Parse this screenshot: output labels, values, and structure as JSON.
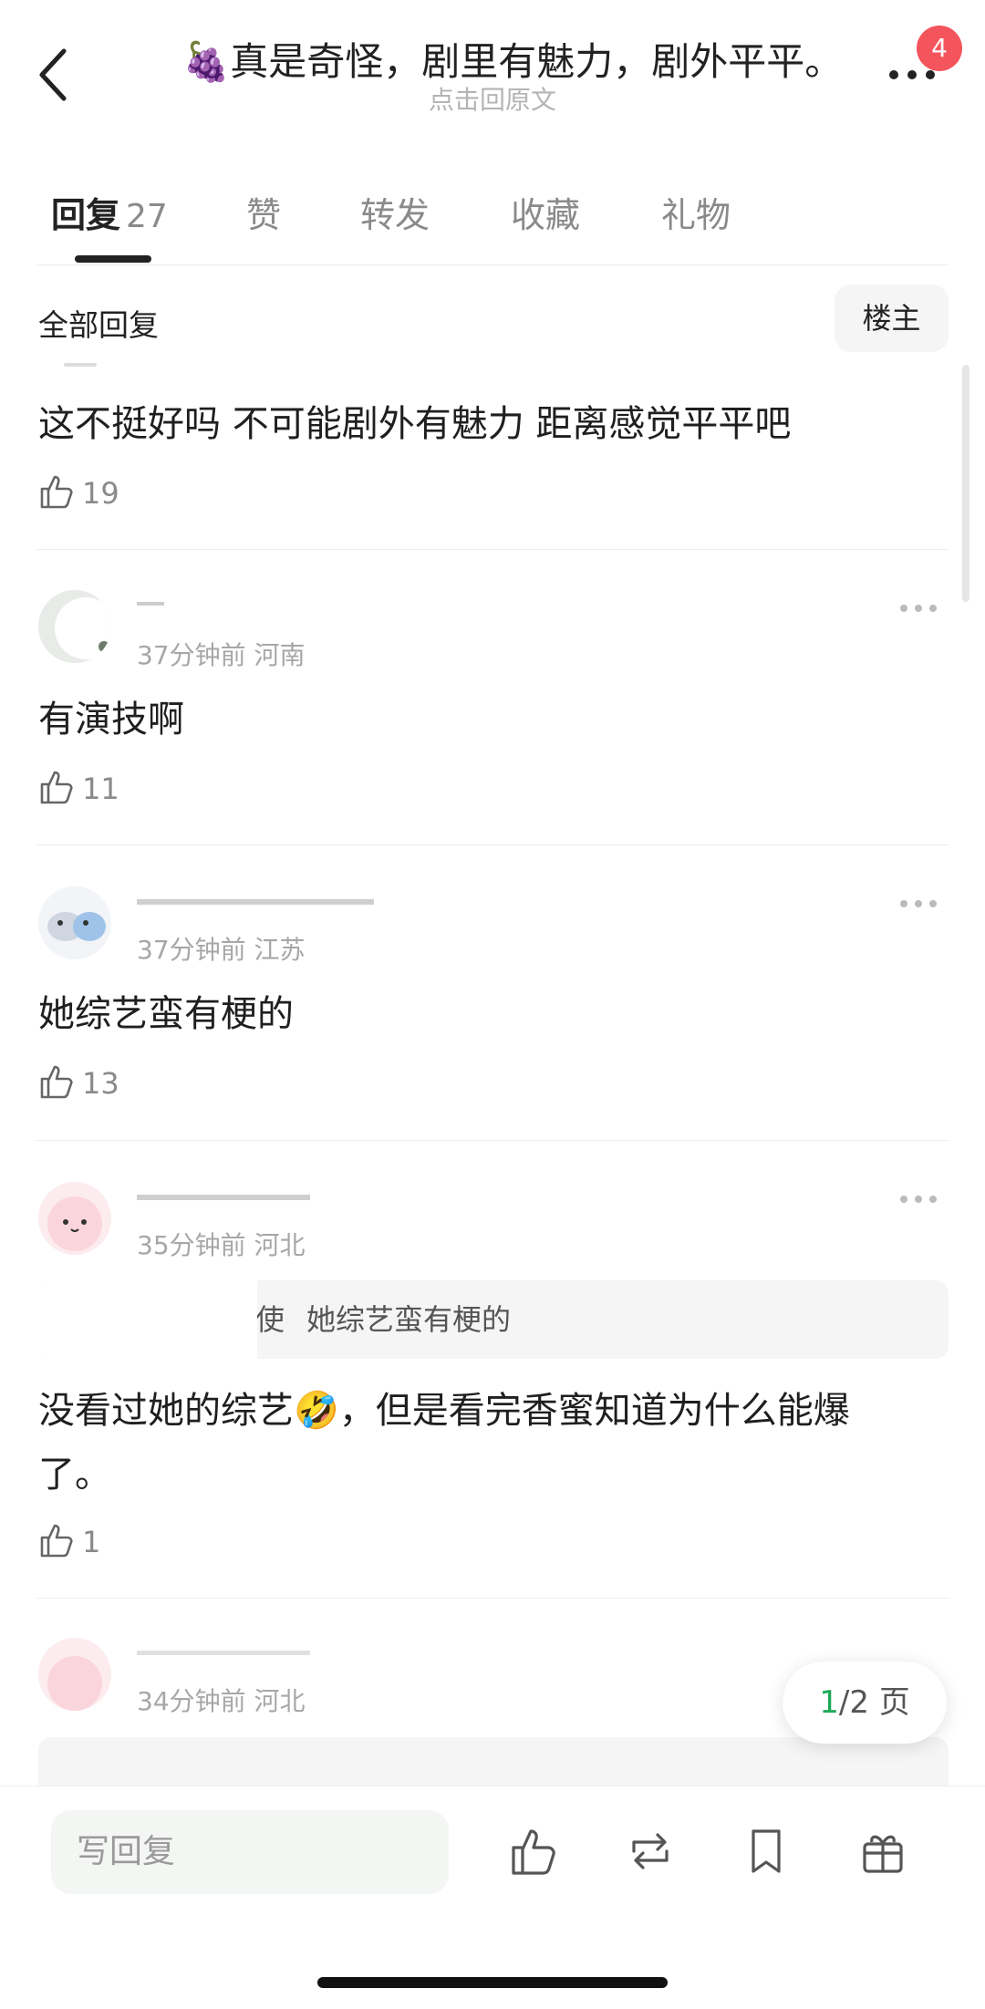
{
  "header": {
    "title_emoji": "🍇",
    "title": "真是奇怪，剧里有魅力，剧外平平。",
    "subtitle": "点击回原文",
    "badge": "4"
  },
  "tabs": [
    {
      "label": "回复",
      "count": "27",
      "active": true
    },
    {
      "label": "赞"
    },
    {
      "label": "转发"
    },
    {
      "label": "收藏"
    },
    {
      "label": "礼物"
    }
  ],
  "filter": {
    "label": "全部回复",
    "owner_button": "楼主"
  },
  "comments": [
    {
      "text": "这不挺好吗 不可能剧外有魅力 距离感觉平平吧",
      "likes": "19"
    },
    {
      "meta": "37分钟前 河南",
      "text": "有演技啊",
      "likes": "11"
    },
    {
      "meta": "37分钟前 江苏",
      "text": "她综艺蛮有梗的",
      "likes": "13"
    },
    {
      "meta": "35分钟前 河北",
      "quote_prefix": "使",
      "quote": "她综艺蛮有梗的",
      "text_line1": "没看过她的综艺🤣，但是看完香蜜知道为什么能爆",
      "text_line2": "了。",
      "likes": "1"
    },
    {
      "meta": "34分钟前 河北"
    }
  ],
  "pagination": {
    "current": "1",
    "rest": "/2 页"
  },
  "bottom_bar": {
    "reply_placeholder": "写回复"
  },
  "colors": {
    "accent": "#20a858",
    "badge": "#f4545b",
    "text": "#1f1f1f",
    "muted": "#a7a7a7"
  }
}
